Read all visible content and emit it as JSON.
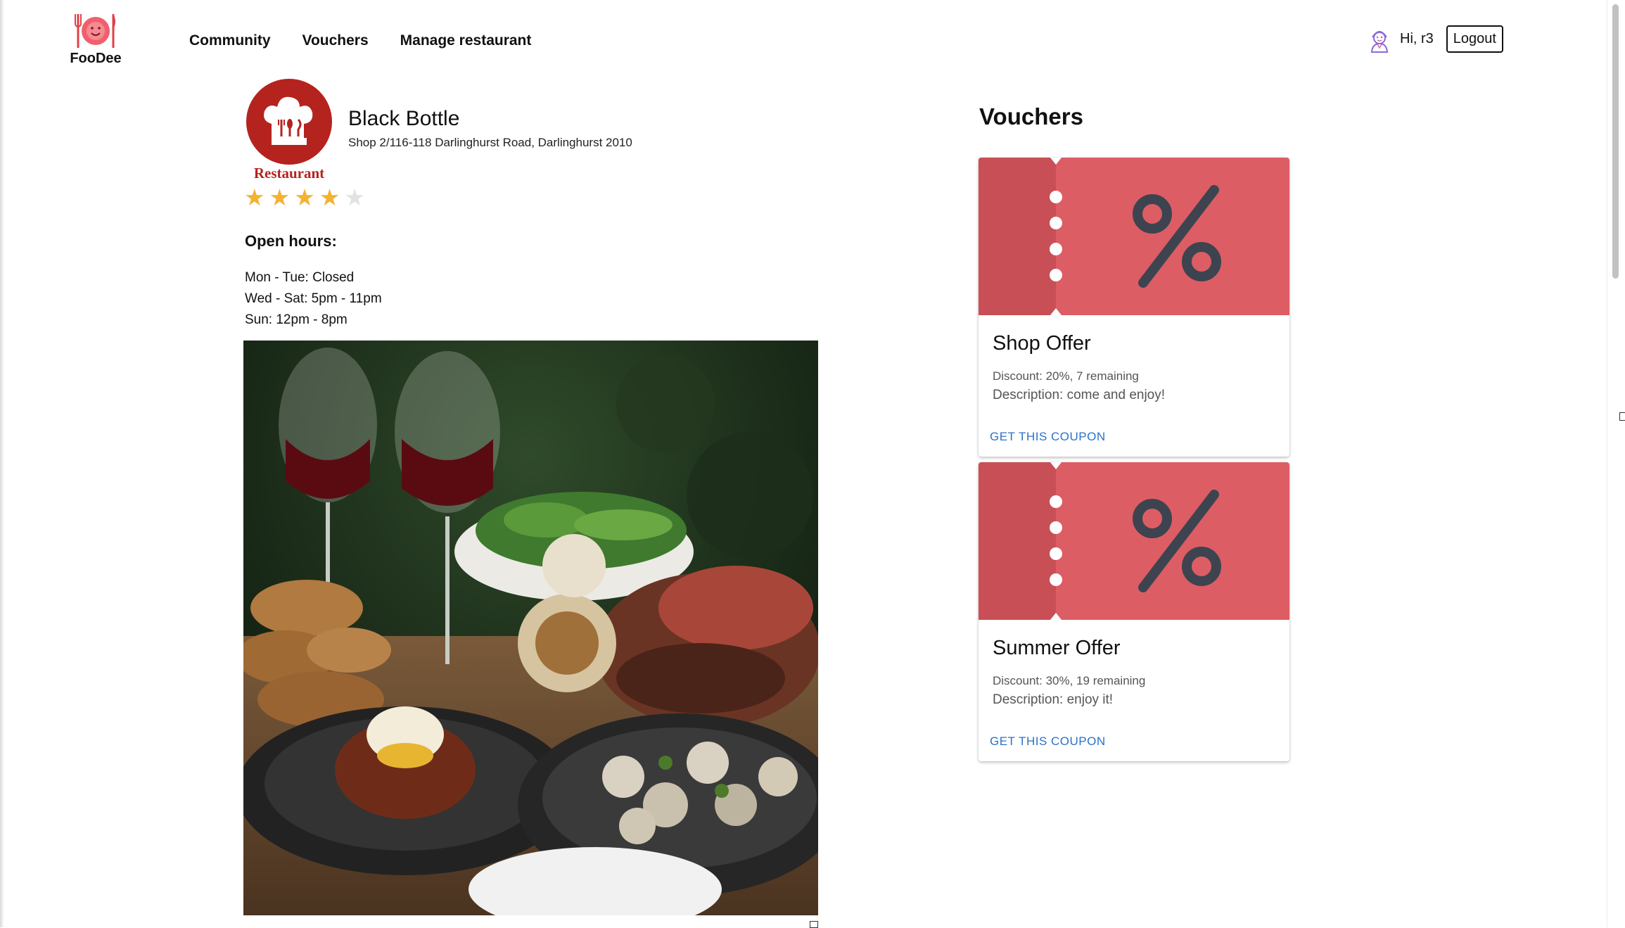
{
  "header": {
    "brand": "FooDee",
    "nav": [
      "Community",
      "Vouchers",
      "Manage restaurant"
    ],
    "greeting": "Hi, r3",
    "logout_label": "Logout"
  },
  "restaurant": {
    "name": "Black Bottle",
    "address": "Shop 2/116-118 Darlinghurst Road, Darlinghurst 2010",
    "logo_text": "Restaurant",
    "rating": 4,
    "rating_max": 5,
    "hours_title": "Open hours:",
    "hours": [
      "Mon - Tue: Closed",
      "Wed - Sat: 5pm - 11pm",
      "Sun: 12pm - 8pm"
    ]
  },
  "vouchers": {
    "title": "Vouchers",
    "items": [
      {
        "name": "Shop Offer",
        "discount": "Discount: 20%, 7 remaining",
        "description": "Description: come and enjoy!",
        "button": "GET THIS COUPON"
      },
      {
        "name": "Summer Offer",
        "discount": "Discount: 30%, 19 remaining",
        "description": "Description: enjoy it!",
        "button": "GET THIS COUPON"
      }
    ]
  },
  "colors": {
    "accent": "#f2b233",
    "brand_red": "#b5231f",
    "ticket": "#dd5d64",
    "link": "#2a72c8"
  }
}
